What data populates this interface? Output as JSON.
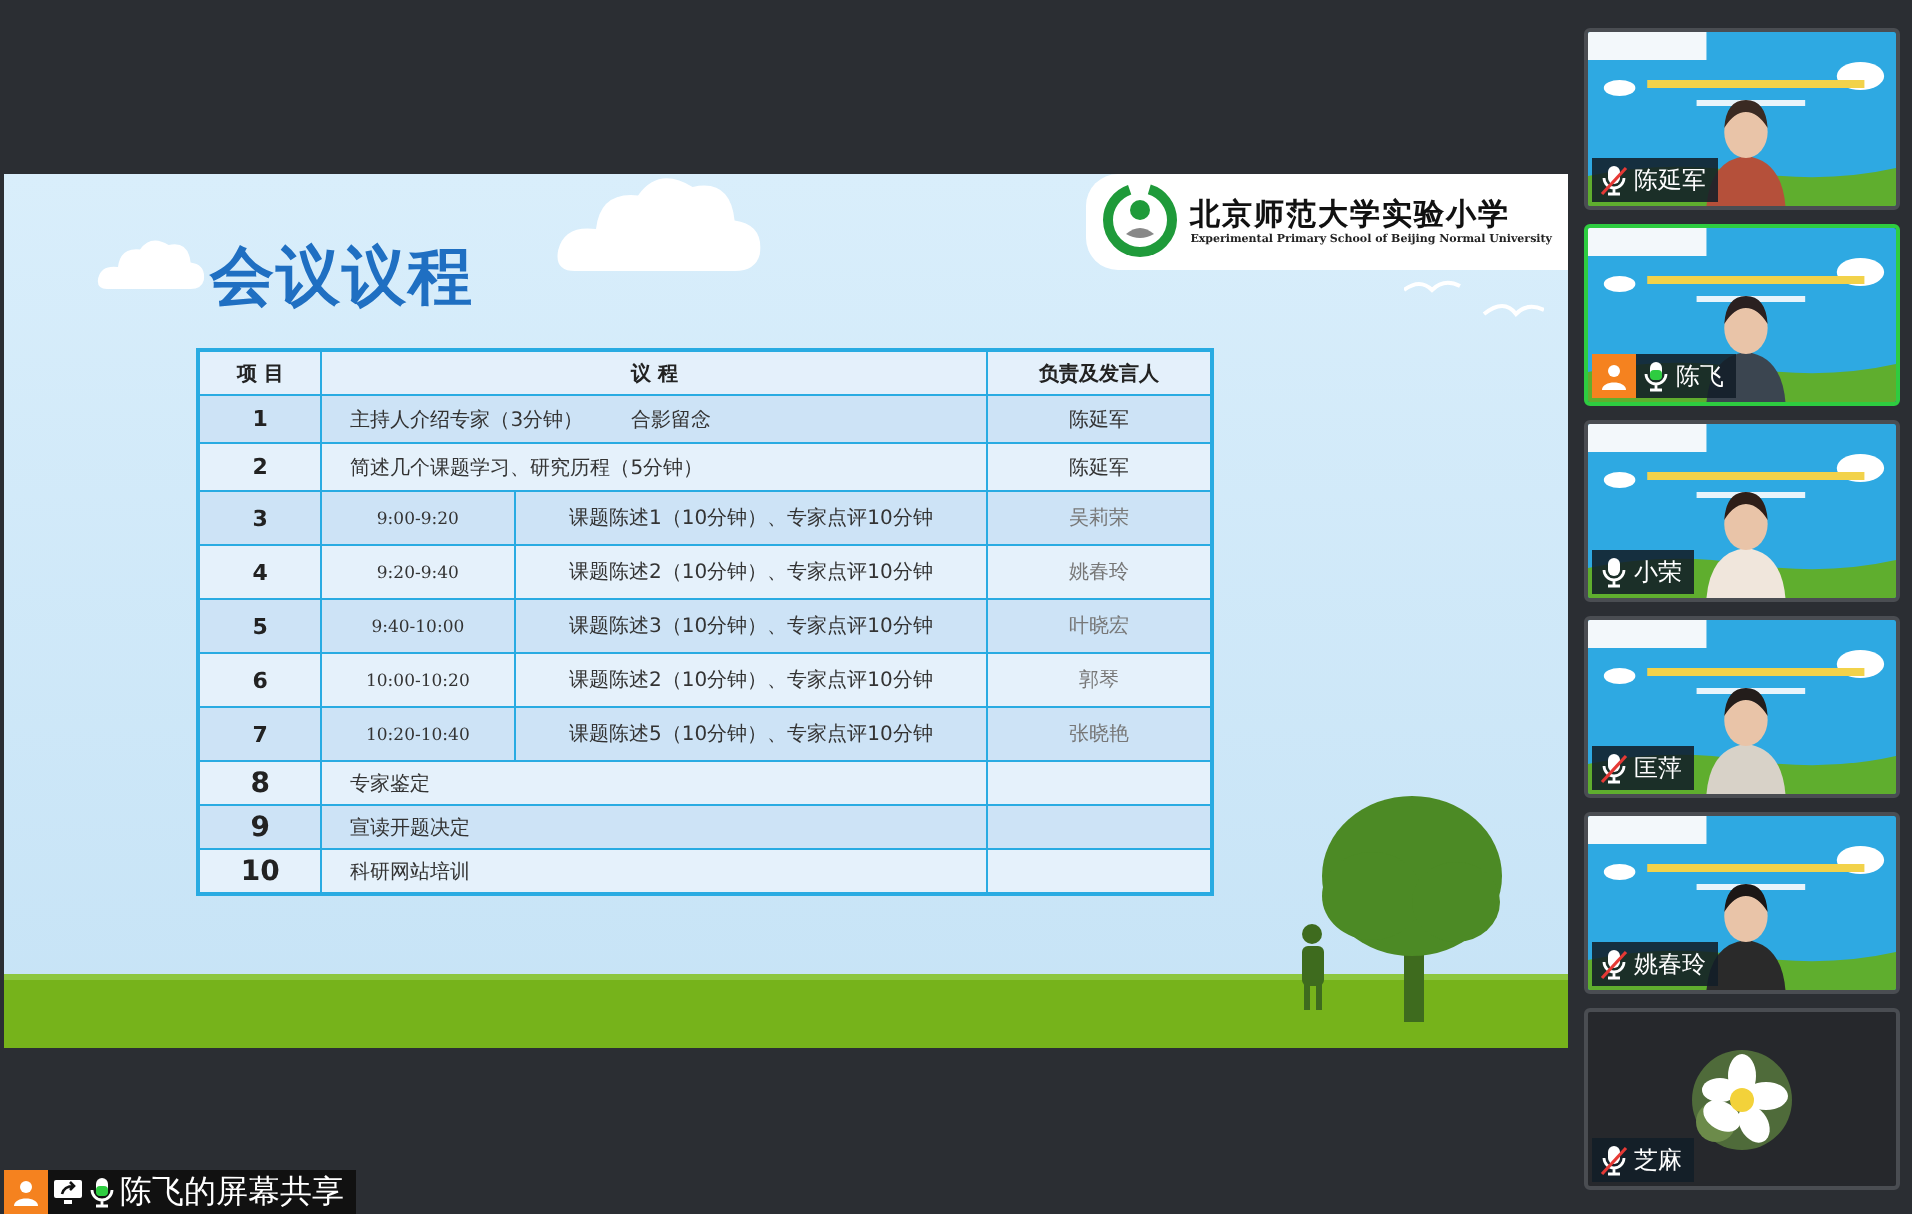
{
  "slide": {
    "title": "会议议程",
    "logo": {
      "name": "北京师范大学实验小学",
      "subtitle": "Experimental Primary School of Beijing Normal University"
    },
    "table": {
      "columns": [
        "项 目",
        "议 程",
        "负责及发言人"
      ],
      "rows": [
        {
          "kind": "single",
          "item": "1",
          "agenda": "主持人介绍专家（3分钟）",
          "extra": "合影留念",
          "speaker": "陈延军"
        },
        {
          "kind": "single",
          "item": "2",
          "agenda": "简述几个课题学习、研究历程（5分钟）",
          "speaker": "陈延军"
        },
        {
          "kind": "timed",
          "item": "3",
          "time": "9:00-9:20",
          "agenda": "课题陈述1（10分钟）、专家点评10分钟",
          "speaker": "吴莉荣"
        },
        {
          "kind": "timed",
          "item": "4",
          "time": "9:20-9:40",
          "agenda": "课题陈述2（10分钟）、专家点评10分钟",
          "speaker": "姚春玲"
        },
        {
          "kind": "timed",
          "item": "5",
          "time": "9:40-10:00",
          "agenda": "课题陈述3（10分钟）、专家点评10分钟",
          "speaker": "叶晓宏"
        },
        {
          "kind": "timed",
          "item": "6",
          "time": "10:00-10:20",
          "agenda": "课题陈述2（10分钟）、专家点评10分钟",
          "speaker": "郭琴"
        },
        {
          "kind": "timed",
          "item": "7",
          "time": "10:20-10:40",
          "agenda": "课题陈述5（10分钟）、专家点评10分钟",
          "speaker": "张晓艳"
        },
        {
          "kind": "single",
          "item": "8",
          "agenda": "专家鉴定"
        },
        {
          "kind": "single",
          "item": "9",
          "agenda": "宣读开题决定"
        },
        {
          "kind": "single",
          "item": "10",
          "agenda": "科研网站培训"
        }
      ]
    }
  },
  "participants": [
    {
      "kind": "video",
      "name": "陈延军",
      "muted": true,
      "speaking": false,
      "self": false
    },
    {
      "kind": "video",
      "name": "陈飞",
      "muted": false,
      "speaking": true,
      "self": true
    },
    {
      "kind": "video",
      "name": "小荣",
      "muted": false,
      "speaking": false,
      "self": false
    },
    {
      "kind": "video",
      "name": "匡萍",
      "muted": true,
      "speaking": false,
      "self": false
    },
    {
      "kind": "video",
      "name": "姚春玲",
      "muted": true,
      "speaking": false,
      "self": false
    },
    {
      "kind": "avatar",
      "name": "芝麻",
      "muted": true,
      "speaking": false,
      "self": false
    }
  ],
  "share_label": {
    "text": "陈飞的屏幕共享",
    "mic_active": true
  }
}
